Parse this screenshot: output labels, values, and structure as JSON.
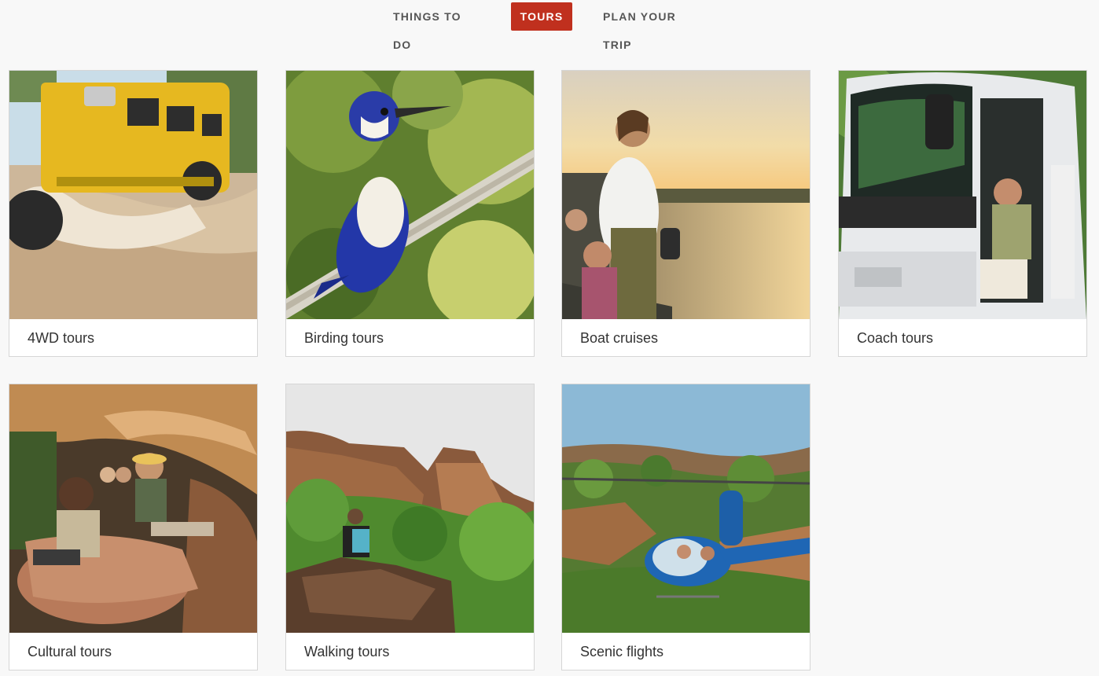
{
  "nav": {
    "items": [
      {
        "label": "THINGS TO DO",
        "active": false
      },
      {
        "label": "TOURS",
        "active": true
      },
      {
        "label": "PLAN YOUR TRIP",
        "active": false
      }
    ],
    "active_color": "#c0301e"
  },
  "tours": [
    {
      "label": "4WD tours"
    },
    {
      "label": "Birding tours"
    },
    {
      "label": "Boat cruises"
    },
    {
      "label": "Coach tours"
    },
    {
      "label": "Cultural tours"
    },
    {
      "label": "Walking tours"
    },
    {
      "label": "Scenic flights"
    }
  ]
}
